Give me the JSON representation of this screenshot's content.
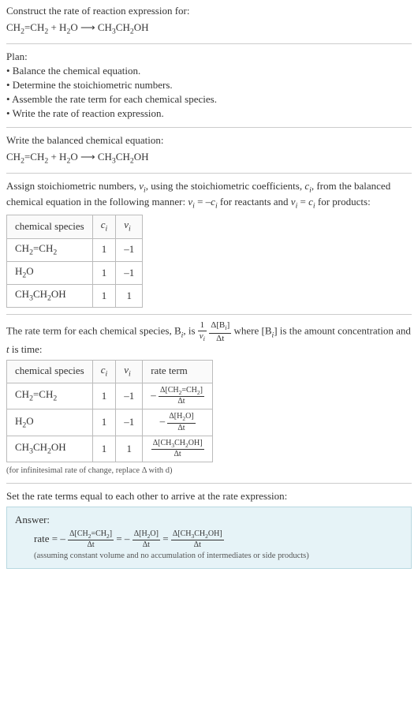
{
  "header": {
    "prompt": "Construct the rate of reaction expression for:",
    "equation_lhs1": "CH",
    "equation_lhs1_sub": "2",
    "equation_lhs2": "=CH",
    "equation_lhs2_sub": "2",
    "equation_plus": " + H",
    "equation_h2o_sub1": "2",
    "equation_h2o_o": "O  ⟶  CH",
    "equation_rhs_sub1": "3",
    "equation_rhs_mid": "CH",
    "equation_rhs_sub2": "2",
    "equation_rhs_end": "OH"
  },
  "plan": {
    "title": "Plan:",
    "item1": "• Balance the chemical equation.",
    "item2": "• Determine the stoichiometric numbers.",
    "item3": "• Assemble the rate term for each chemical species.",
    "item4": "• Write the rate of reaction expression."
  },
  "balanced": {
    "title": "Write the balanced chemical equation:"
  },
  "stoich": {
    "intro1": "Assign stoichiometric numbers, ",
    "nu": "ν",
    "i": "i",
    "intro2": ", using the stoichiometric coefficients, ",
    "c": "c",
    "intro3": ", from the balanced chemical equation in the following manner: ",
    "rel1": " = –",
    "intro4": " for reactants and ",
    "rel2": " = ",
    "intro5": " for products:",
    "hdr_species": "chemical species",
    "hdr_ci": "c",
    "hdr_nui": "ν",
    "r1_sp_a": "CH",
    "r1_sp_sub1": "2",
    "r1_sp_b": "=CH",
    "r1_sp_sub2": "2",
    "r1_c": "1",
    "r1_nu": "–1",
    "r2_sp_a": "H",
    "r2_sp_sub1": "2",
    "r2_sp_b": "O",
    "r2_c": "1",
    "r2_nu": "–1",
    "r3_sp_a": "CH",
    "r3_sp_sub1": "3",
    "r3_sp_b": "CH",
    "r3_sp_sub2": "2",
    "r3_sp_c": "OH",
    "r3_c": "1",
    "r3_nu": "1"
  },
  "rateterm": {
    "intro1": "The rate term for each chemical species, B",
    "intro2": ", is ",
    "one": "1",
    "nu_i": "ν",
    "dbi": "Δ[B",
    "dbi_close": "]",
    "dt": "Δt",
    "intro3": " where [B",
    "intro4": "] is the amount concentration and ",
    "t": "t",
    "intro5": " is time:",
    "hdr_species": "chemical species",
    "hdr_ci": "c",
    "hdr_nui": "ν",
    "hdr_rate": "rate term",
    "r1_c": "1",
    "r1_nu": "–1",
    "r1_num": "Δ[CH",
    "r1_num_sub1": "2",
    "r1_num_mid": "=CH",
    "r1_num_sub2": "2",
    "r1_num_end": "]",
    "r2_c": "1",
    "r2_nu": "–1",
    "r2_num": "Δ[H",
    "r2_num_sub1": "2",
    "r2_num_end": "O]",
    "r3_c": "1",
    "r3_nu": "1",
    "r3_num": "Δ[CH",
    "r3_num_sub1": "3",
    "r3_num_mid": "CH",
    "r3_num_sub2": "2",
    "r3_num_end": "OH]",
    "note": "(for infinitesimal rate of change, replace Δ with d)",
    "minus": "– ",
    "i": "i"
  },
  "final": {
    "title": "Set the rate terms equal to each other to arrive at the rate expression:",
    "answer_label": "Answer:",
    "rate": "rate = – ",
    "eq": " = – ",
    "eq2": " = ",
    "assump": "(assuming constant volume and no accumulation of intermediates or side products)"
  }
}
